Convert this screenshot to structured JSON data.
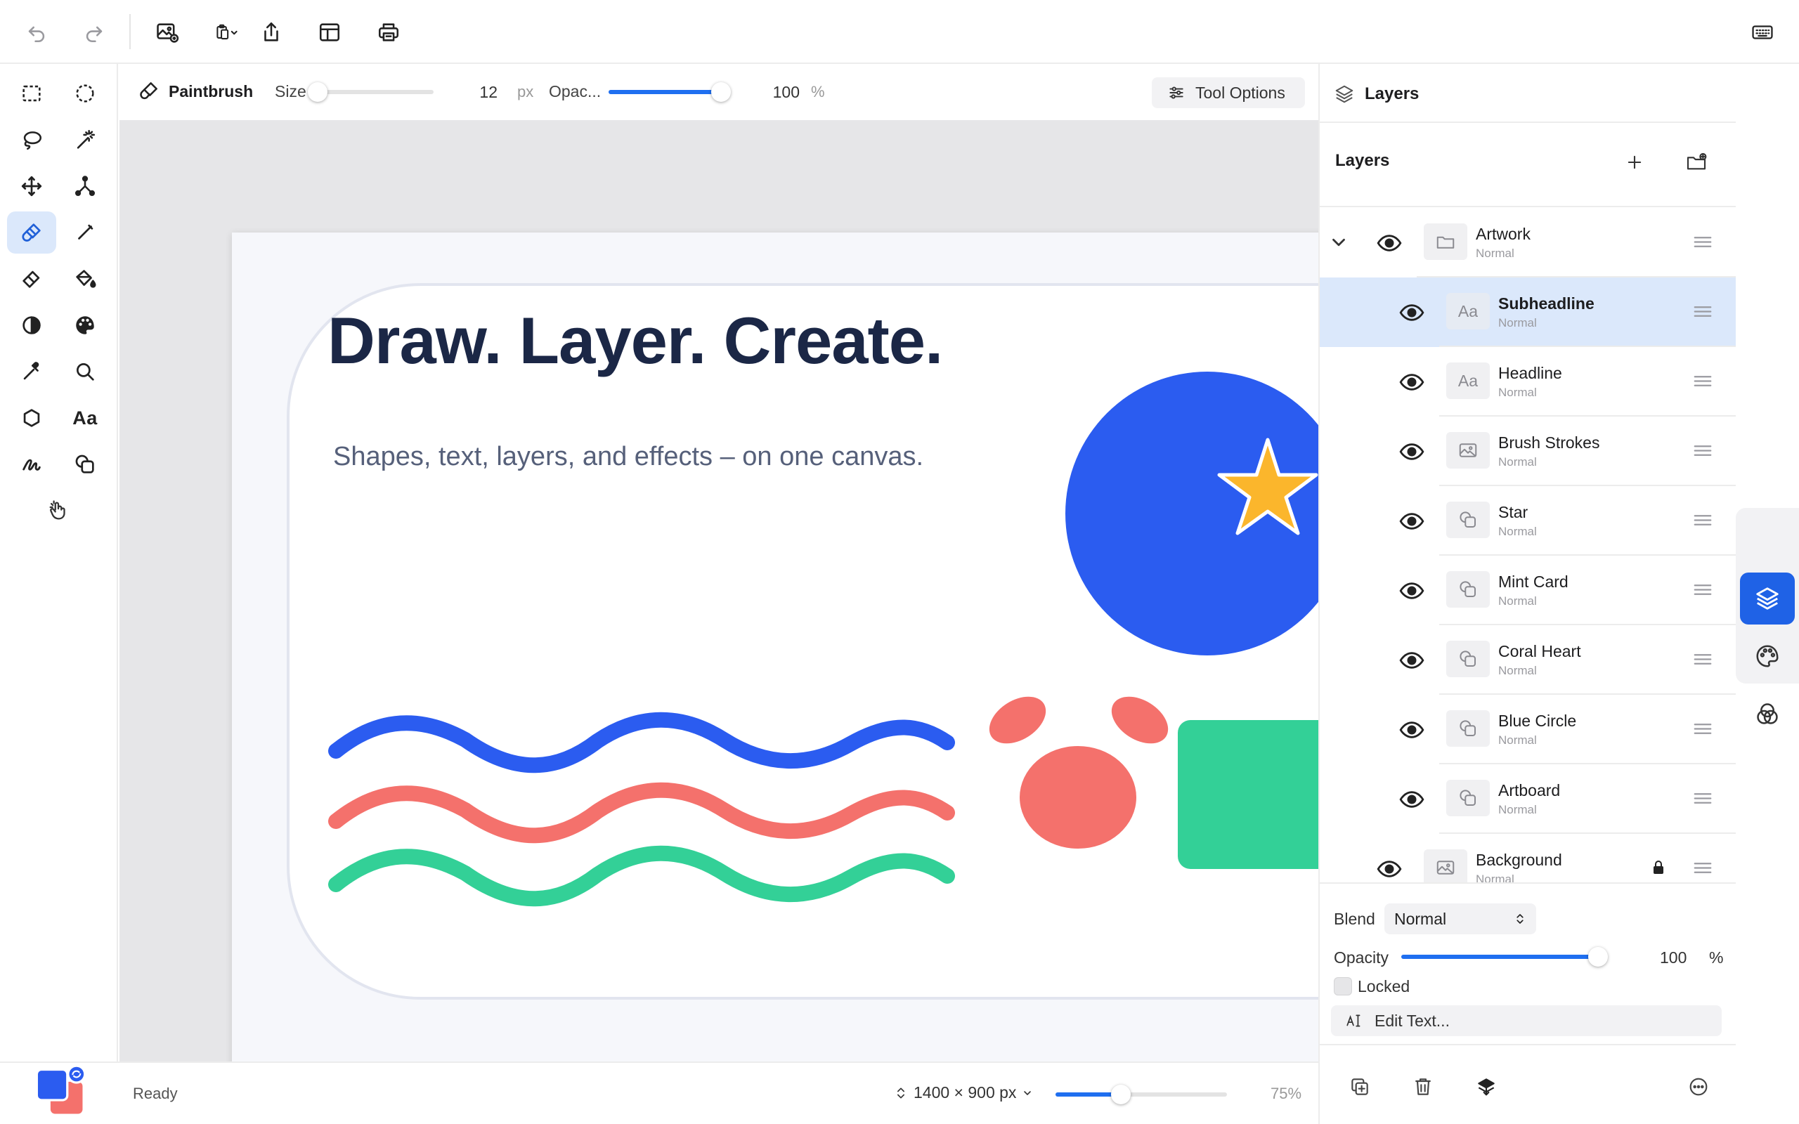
{
  "options_bar": {
    "tool_name": "Paintbrush",
    "size_label": "Size",
    "size_value": "12",
    "size_unit": "px",
    "size_fraction": 0.03,
    "opacity_label": "Opac...",
    "opacity_value": "100",
    "opacity_unit": "%",
    "opacity_fraction": 1.0,
    "tool_options_label": "Tool Options"
  },
  "canvas": {
    "headline": "Draw. Layer. Create.",
    "subheadline": "Shapes, text, layers, and effects – on one canvas.",
    "colors": {
      "navy": "#1b2746",
      "blue": "#2b5cf0",
      "coral": "#f4716c",
      "mint": "#33d097",
      "star": "#fbb62c"
    }
  },
  "status_bar": {
    "status": "Ready",
    "doc_size": "1400 × 900 px",
    "zoom_label": "75%",
    "zoom_fraction": 0.38
  },
  "layers_panel": {
    "panel_title": "Layers",
    "section_title": "Layers",
    "layers": [
      {
        "name": "Artwork",
        "mode": "Normal",
        "kind": "group"
      },
      {
        "name": "Subheadline",
        "mode": "Normal",
        "kind": "text",
        "selected": true
      },
      {
        "name": "Headline",
        "mode": "Normal",
        "kind": "text"
      },
      {
        "name": "Brush Strokes",
        "mode": "Normal",
        "kind": "image"
      },
      {
        "name": "Star",
        "mode": "Normal",
        "kind": "shape"
      },
      {
        "name": "Mint Card",
        "mode": "Normal",
        "kind": "shape"
      },
      {
        "name": "Coral Heart",
        "mode": "Normal",
        "kind": "shape"
      },
      {
        "name": "Blue Circle",
        "mode": "Normal",
        "kind": "shape"
      },
      {
        "name": "Artboard",
        "mode": "Normal",
        "kind": "shape"
      },
      {
        "name": "Background",
        "mode": "Normal",
        "kind": "image",
        "locked": true
      }
    ],
    "text_thumb": "Aa",
    "blend_label": "Blend",
    "blend_value": "Normal",
    "opacity_label": "Opacity",
    "opacity_value": "100",
    "opacity_unit": "%",
    "opacity_fraction": 1.0,
    "locked_label": "Locked",
    "edit_text_label": "Edit Text..."
  },
  "tools": {
    "text_tool_glyph": "Aa"
  },
  "accent_color": "#1f6ff0"
}
